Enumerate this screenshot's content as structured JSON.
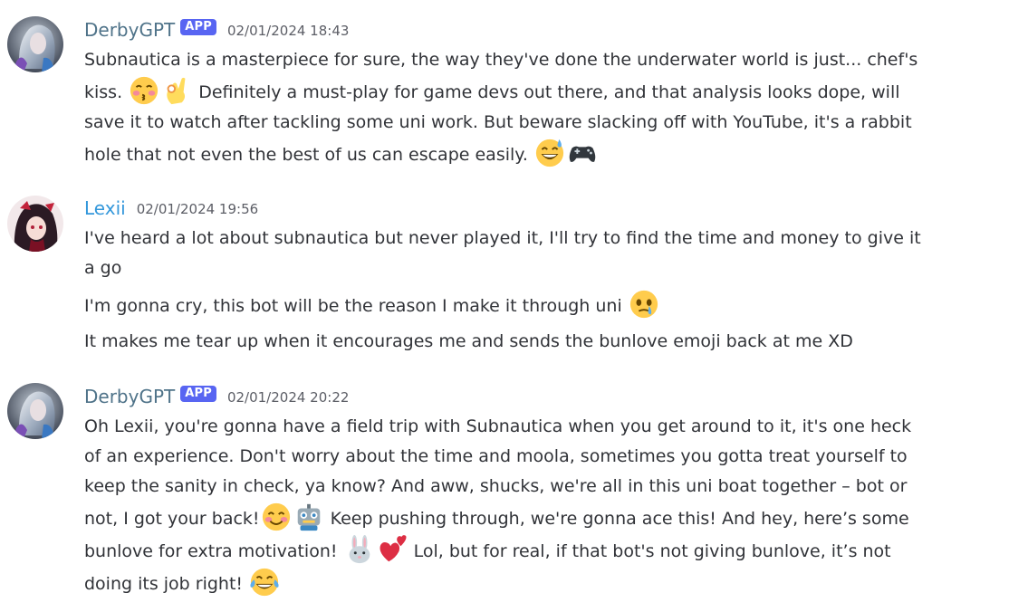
{
  "messages": [
    {
      "author": "DerbyGPT",
      "author_color": "#4f7389",
      "badge": "APP",
      "timestamp": "02/01/2024 18:43",
      "lines": [
        {
          "text": "Subnautica is a masterpiece for sure, the way they've done the underwater world is just... chef's"
        },
        {
          "text": "kiss.",
          "emojis_after": [
            "kissing-face-emoji",
            "ok-hand-emoji"
          ],
          "text2": " Definitely a must-play for game devs out there, and that analysis looks dope, will"
        },
        {
          "text": "save it to watch after tackling some uni work. But beware slacking off with YouTube, it's a rabbit"
        },
        {
          "text": "hole that not even the best of us can escape easily.",
          "emojis_after": [
            "grinning-sweat-emoji",
            "game-controller-emoji"
          ]
        }
      ]
    },
    {
      "author": "Lexii",
      "author_color": "#3498db",
      "timestamp": "02/01/2024 19:56",
      "lines": [
        {
          "text": "I've heard a lot about subnautica but never played it, I'll try to find the time and money to give it"
        },
        {
          "text": "a go"
        },
        {
          "text": "I'm gonna cry, this bot will be the reason I make it through uni",
          "emojis_after": [
            "holding-back-tears-emoji"
          ]
        },
        {
          "text": "It makes me tear up when it encourages me and sends the bunlove emoji back at me XD"
        }
      ]
    },
    {
      "author": "DerbyGPT",
      "author_color": "#4f7389",
      "badge": "APP",
      "timestamp": "02/01/2024 20:22",
      "lines": [
        {
          "text": "Oh Lexii, you're gonna have a field trip with Subnautica when you get around to it, it's one heck"
        },
        {
          "text": "of an experience. Don't worry about the time and moola, sometimes you gotta treat yourself to"
        },
        {
          "text": "keep the sanity in check, ya know? And aww, shucks, we're all in this uni boat together – bot or"
        },
        {
          "text": "not, I got your back!",
          "emojis_after": [
            "smiling-blush-emoji",
            "robot-emoji"
          ],
          "text2": " Keep pushing through, we're gonna ace this! And hey, here’s some"
        },
        {
          "text": "bunlove for extra motivation!",
          "emojis_after": [
            "rabbit-emoji",
            "two-hearts-emoji"
          ],
          "text2": " Lol, but for real, if that bot's not giving bunlove, it’s not"
        },
        {
          "text": "doing its job right!",
          "emojis_after": [
            "tears-of-joy-emoji"
          ]
        }
      ]
    }
  ]
}
